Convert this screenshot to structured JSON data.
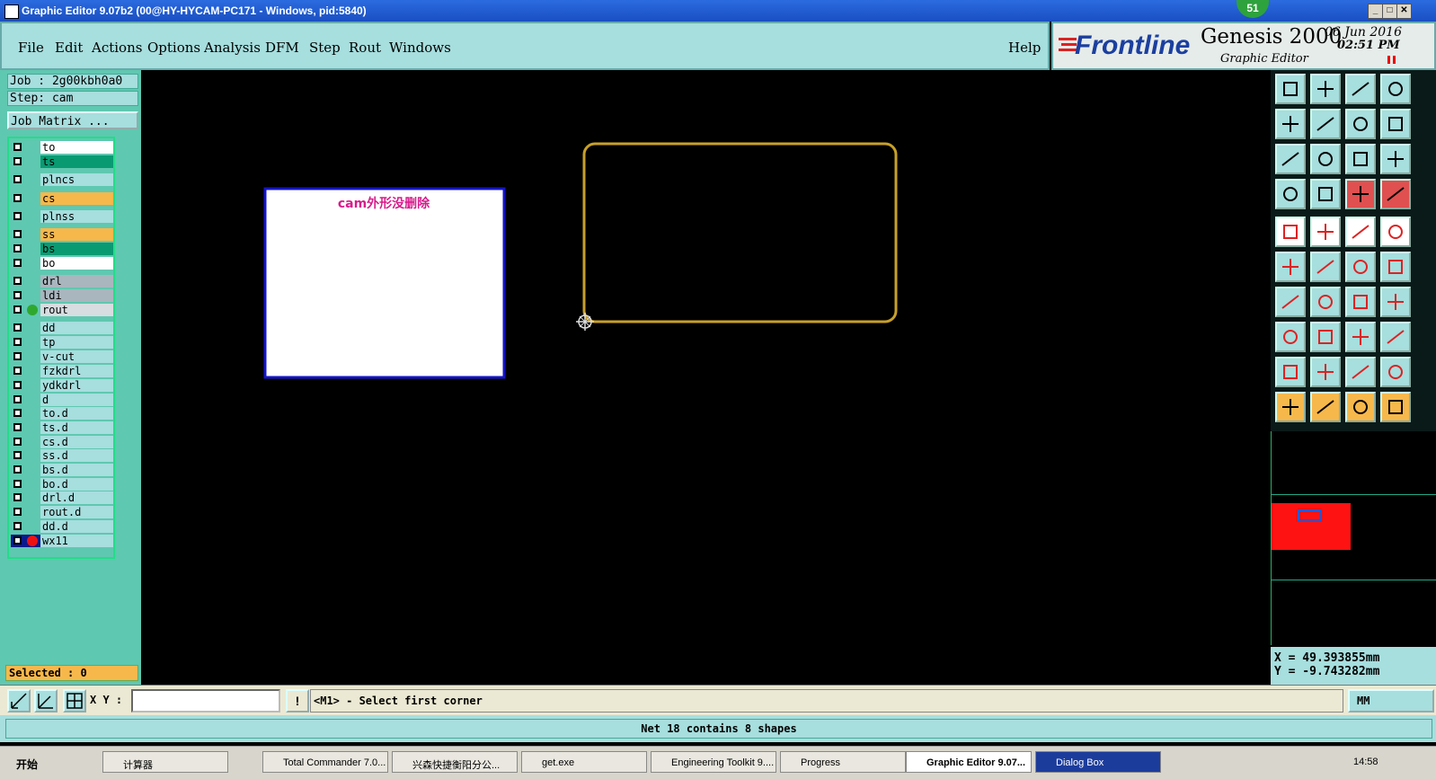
{
  "window": {
    "title": "Graphic Editor 9.07b2 (00@HY-HYCAM-PC171 - Windows, pid:5840)",
    "badge": "51",
    "min_glyph": "_",
    "max_glyph": "□",
    "close_glyph": "✕"
  },
  "menu": {
    "items": [
      "File",
      "Edit",
      "Actions",
      "Options",
      "Analysis",
      "DFM",
      "Step",
      "Rout",
      "Windows"
    ],
    "help": "Help"
  },
  "logo": {
    "brand": "Frontline",
    "product": "Genesis 2000",
    "subtitle": "Graphic Editor",
    "date": "06 Jun 2016",
    "time": "02:51 PM"
  },
  "job": {
    "job_label": "Job : 2g00kbh0a0",
    "step_label": "Step: cam",
    "matrix_button": "Job Matrix ..."
  },
  "layers": [
    {
      "name": "to",
      "color": "#ffffff"
    },
    {
      "name": "ts",
      "color": "#0a9a72"
    },
    {
      "name": "plncs",
      "color": "#a7dede"
    },
    {
      "name": "cs",
      "color": "#f7b84b"
    },
    {
      "name": "plnss",
      "color": "#a7dede"
    },
    {
      "name": "ss",
      "color": "#f7b84b"
    },
    {
      "name": "bs",
      "color": "#0a9a72"
    },
    {
      "name": "bo",
      "color": "#ffffff"
    },
    {
      "name": "drl",
      "color": "#a9b6be"
    },
    {
      "name": "ldi",
      "color": "#a9b6be"
    },
    {
      "name": "rout",
      "color": "#d7dde0",
      "indicator": "#2fa82f"
    },
    {
      "name": "dd",
      "color": "#a7dede"
    },
    {
      "name": "tp",
      "color": "#a7dede"
    },
    {
      "name": "v-cut",
      "color": "#a7dede"
    },
    {
      "name": "fzkdrl",
      "color": "#a7dede"
    },
    {
      "name": "ydkdrl",
      "color": "#a7dede"
    },
    {
      "name": "d",
      "color": "#a7dede"
    },
    {
      "name": "to.d",
      "color": "#a7dede"
    },
    {
      "name": "ts.d",
      "color": "#a7dede"
    },
    {
      "name": "cs.d",
      "color": "#a7dede"
    },
    {
      "name": "ss.d",
      "color": "#a7dede"
    },
    {
      "name": "bs.d",
      "color": "#a7dede"
    },
    {
      "name": "bo.d",
      "color": "#a7dede"
    },
    {
      "name": "drl.d",
      "color": "#a7dede"
    },
    {
      "name": "rout.d",
      "color": "#a7dede"
    },
    {
      "name": "dd.d",
      "color": "#a7dede"
    },
    {
      "name": "wx11",
      "color": "#a7dede",
      "indicator": "#ee1111",
      "active": true
    }
  ],
  "selected": "Selected : 0",
  "canvas": {
    "note": "cam外形没删除",
    "outline_color": "#c8a028",
    "note_color": "#d81b8c"
  },
  "coords": {
    "x": "X = 49.393855mm",
    "y": "Y = -9.743282mm"
  },
  "bottom": {
    "xy_label": "X Y :",
    "xy_value": "",
    "prompt": "<M1> - Select first corner",
    "units": "MM",
    "status": "Net 18 contains 8 shapes"
  },
  "taskbar": {
    "start": "开始",
    "items": [
      "计算器",
      "Total Commander 7.0...",
      "兴森快捷衡阳分公...",
      "get.exe",
      "Engineering Toolkit 9....",
      "Progress",
      "Graphic Editor 9.07...",
      "Dialog Box"
    ],
    "clock": "14:58"
  }
}
